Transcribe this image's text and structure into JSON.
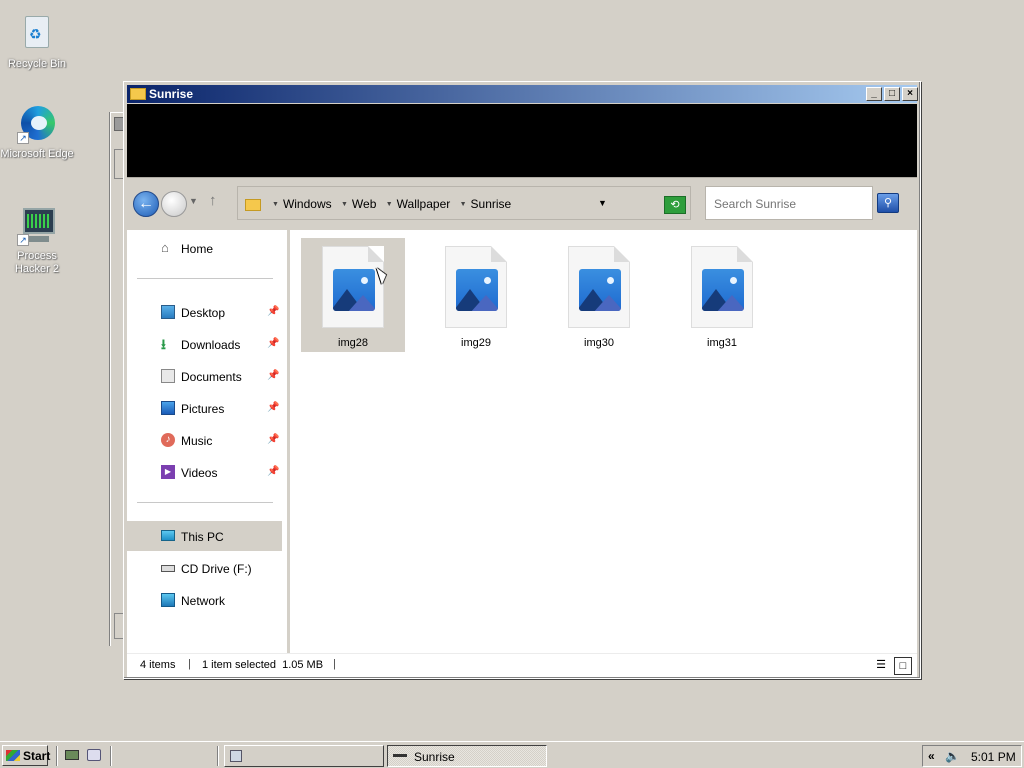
{
  "desktop": {
    "icons": [
      {
        "label": "Recycle Bin"
      },
      {
        "label": "Microsoft Edge"
      },
      {
        "label": "Process\nHacker 2"
      }
    ]
  },
  "window": {
    "title": "Sunrise",
    "buttons": {
      "minimize": "_",
      "maximize": "□",
      "close": "×"
    }
  },
  "address_bar": {
    "crumbs": [
      "Windows",
      "Web",
      "Wallpaper",
      "Sunrise"
    ]
  },
  "search": {
    "placeholder": "Search Sunrise"
  },
  "sidebar": {
    "items": [
      {
        "label": "Home",
        "icon": "home-icon",
        "pinned": false
      },
      {
        "label": "Desktop",
        "icon": "desktop-icon",
        "pinned": true
      },
      {
        "label": "Downloads",
        "icon": "download-icon",
        "pinned": true
      },
      {
        "label": "Documents",
        "icon": "document-icon",
        "pinned": true
      },
      {
        "label": "Pictures",
        "icon": "pictures-icon",
        "pinned": true
      },
      {
        "label": "Music",
        "icon": "music-icon",
        "pinned": true
      },
      {
        "label": "Videos",
        "icon": "videos-icon",
        "pinned": true
      },
      {
        "label": "This PC",
        "icon": "computer-icon",
        "selected": true
      },
      {
        "label": "CD Drive (F:)",
        "icon": "cd-drive-icon"
      },
      {
        "label": "Network",
        "icon": "network-icon"
      }
    ]
  },
  "files": [
    {
      "name": "img28",
      "selected": true
    },
    {
      "name": "img29"
    },
    {
      "name": "img30"
    },
    {
      "name": "img31"
    }
  ],
  "status": {
    "count": "4 items",
    "selection": "1 item selected  1.05 MB"
  },
  "taskbar": {
    "start_label": "Start",
    "tasks": [
      {
        "label": ""
      },
      {
        "label": "Sunrise"
      }
    ],
    "tray": {
      "chevron": "«",
      "clock": "5:01 PM"
    }
  },
  "colors": {
    "titlebar_start": "#0a246a",
    "titlebar_end": "#a6caf0",
    "face": "#d4d0c8",
    "selection": "#d4d0c8"
  }
}
